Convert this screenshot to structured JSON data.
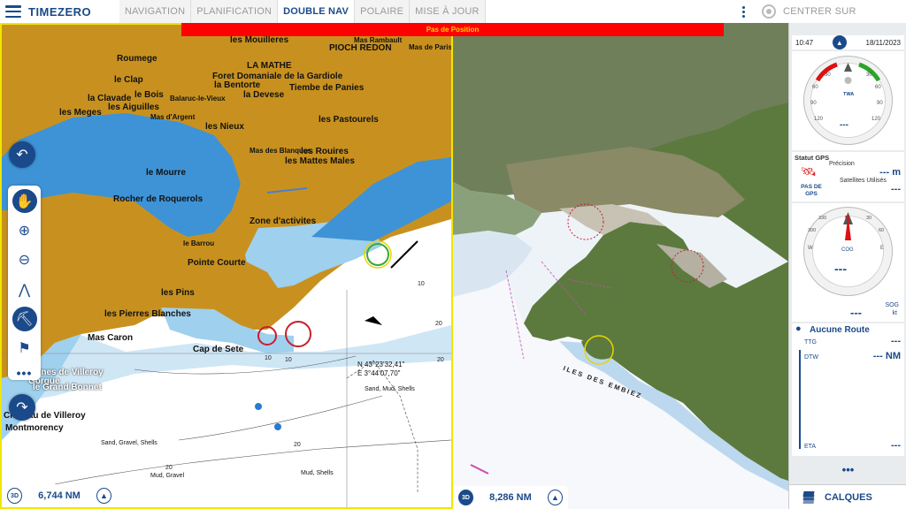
{
  "app": {
    "brand": "TIMEZERO",
    "colors": {
      "primary": "#1a4a8a",
      "alarm_bg": "#ff0000",
      "alarm_text": "#ffd200",
      "land": "#c8911f",
      "shallow": "#9fd0ee",
      "deep": "#ffffff"
    }
  },
  "tabs": [
    {
      "label": "NAVIGATION",
      "active": false
    },
    {
      "label": "PLANIFICATION",
      "active": false
    },
    {
      "label": "DOUBLE NAV",
      "active": true
    },
    {
      "label": "POLAIRE",
      "active": false
    },
    {
      "label": "MISE À JOUR",
      "active": false
    }
  ],
  "header_right": {
    "center_label": "CENTRER SUR"
  },
  "alarm": {
    "text": "Pas de Position"
  },
  "left_map": {
    "places": [
      "les Mouilleres",
      "PIOCH REDON",
      "Mas Rambault",
      "Mas de Paris",
      "Roumege",
      "LA MATHE",
      "Foret Domaniale de la Gardiole",
      "la Bentorte",
      "la Devese",
      "le Clap",
      "Tiembe de Panies",
      "la Clavade",
      "le Bois",
      "Balaruc-le-Vieux",
      "les Meges",
      "les Aiguilles",
      "les Nieux",
      "les Pastourels",
      "Mas d'Argent",
      "Mas des Blanques",
      "le Mourre",
      "les Rouires",
      "les Mattes Males",
      "Rocher de Roquerols",
      "Zone d'activites",
      "Pointe Courte",
      "le Barrou",
      "les Pins",
      "les Pierres Blanches",
      "Mas Caron",
      "Cap de Sete",
      "Calines de Villeroy",
      "Gorgue",
      "le Grand Bonnet",
      "Château de Villeroy",
      "Montmorency",
      "Sand, Gravel, Shells",
      "Mud, Gravel",
      "Mud, Shells",
      "Sand, Mud, Shells"
    ],
    "position_readout": {
      "lat": "N 43°23'32,41\"",
      "lon": "E 3°44'07,70\""
    },
    "depths": [
      "10",
      "10",
      "20",
      "20",
      "20",
      "20",
      "10"
    ],
    "footer": {
      "mode": "3D",
      "distance": "6,744 NM"
    }
  },
  "right_map": {
    "labels": [
      "ILES DES EMBIEZ"
    ],
    "footer": {
      "mode": "3D",
      "distance": "8,286 NM"
    }
  },
  "panel": {
    "time": "10:47",
    "date": "18/11/2023",
    "wind_gauge": {
      "label": "TWA",
      "value": "---",
      "ticks": [
        "30",
        "60",
        "90",
        "120",
        "30",
        "60",
        "90",
        "120"
      ]
    },
    "gps": {
      "title": "Statut GPS",
      "status": "PAS DE GPS",
      "precision_label": "Précision",
      "precision_value": "--- m",
      "satellites_label": "Satellites Utilisés",
      "satellites_value": "---"
    },
    "compass": {
      "label": "COG",
      "value": "---",
      "north": "N",
      "ticks": [
        "330",
        "300",
        "W",
        "30",
        "60",
        "E"
      ]
    },
    "sog": {
      "value": "---",
      "label": "SOG",
      "unit": "kt"
    },
    "route": {
      "title": "Aucune Route",
      "ttg_label": "TTG",
      "ttg_value": "---",
      "dtw_label": "DTW",
      "dtw_value": "--- NM",
      "eta_label": "ETA",
      "eta_value": "---"
    },
    "more": "•••",
    "layers_label": "CALQUES"
  },
  "toolbar": {
    "more": "•••"
  }
}
